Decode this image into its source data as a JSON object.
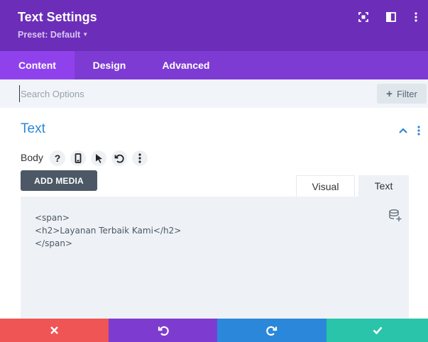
{
  "header": {
    "title": "Text Settings",
    "preset_label": "Preset: Default",
    "icons": [
      "expand-icon",
      "sidebar-layout-icon",
      "more-vertical-icon"
    ]
  },
  "tabs": [
    {
      "label": "Content",
      "active": true
    },
    {
      "label": "Design",
      "active": false
    },
    {
      "label": "Advanced",
      "active": false
    }
  ],
  "search": {
    "placeholder": "Search Options",
    "value": "",
    "filter_label": "Filter"
  },
  "section": {
    "title": "Text",
    "icons": [
      "chevron-up-icon",
      "more-vertical-icon"
    ]
  },
  "field": {
    "label": "Body",
    "tools": [
      "help-icon",
      "mobile-icon",
      "pointer-icon",
      "undo-icon",
      "more-vertical-icon"
    ],
    "add_media_label": "ADD MEDIA",
    "editor_tabs": [
      {
        "label": "Visual",
        "active": false
      },
      {
        "label": "Text",
        "active": true
      }
    ],
    "code_lines": [
      "<span>",
      "<h2>Layanan Terbaik Kami</h2>",
      "</span>"
    ]
  },
  "footer": {
    "buttons": [
      {
        "icon": "close-icon",
        "color": "#ef5555"
      },
      {
        "icon": "undo-icon",
        "color": "#7e3bd0"
      },
      {
        "icon": "redo-icon",
        "color": "#2b87da"
      },
      {
        "icon": "check-icon",
        "color": "#29c4a9"
      }
    ]
  },
  "colors": {
    "header_bg": "#6c2eb9",
    "tabs_bg": "#7d3bd3",
    "active_tab_bg": "#8f42ec",
    "accent_blue": "#2b87da"
  }
}
